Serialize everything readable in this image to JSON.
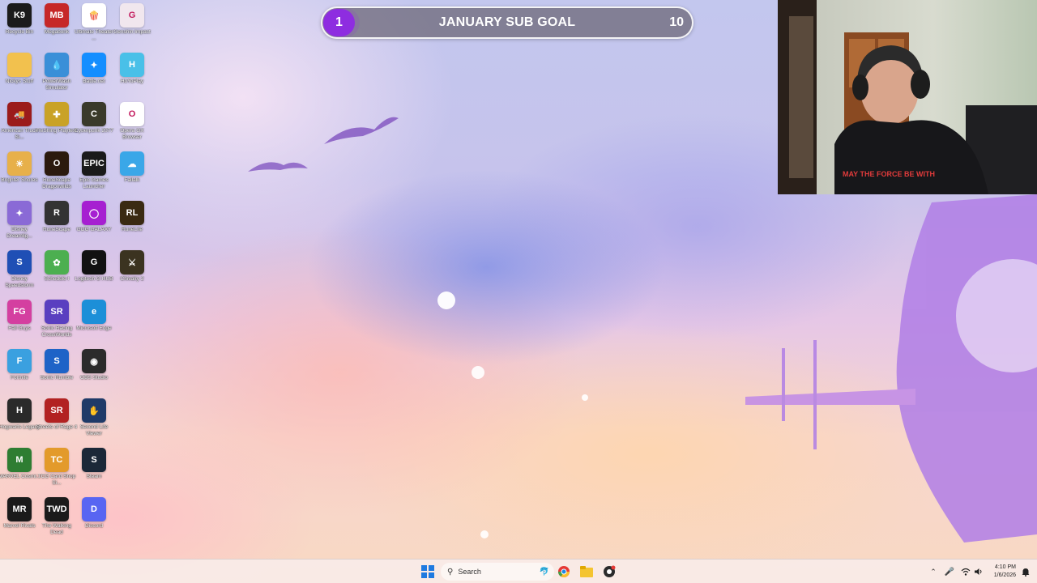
{
  "desktop_icons": [
    {
      "label": "Recycle Bin",
      "glyph": "K9",
      "color": "#1b1b1b"
    },
    {
      "label": "Nickys Stuff",
      "glyph": "",
      "color": "#f2c14e"
    },
    {
      "label": "American Truck Si...",
      "glyph": "🚚",
      "color": "#9b1b1b"
    },
    {
      "label": "Brighter Shores",
      "glyph": "☀",
      "color": "#e7b04a"
    },
    {
      "label": "Disney Dreamlig...",
      "glyph": "✦",
      "color": "#8a6ad6"
    },
    {
      "label": "Disney Speedstorm",
      "glyph": "S",
      "color": "#1f4fb5"
    },
    {
      "label": "Fall Guys",
      "glyph": "FG",
      "color": "#d43fa0"
    },
    {
      "label": "Fortnite",
      "glyph": "F",
      "color": "#3aa0e0"
    },
    {
      "label": "Hogwarts Legacy",
      "glyph": "H",
      "color": "#2a2a2a"
    },
    {
      "label": "MARVEL Cosmi...",
      "glyph": "M",
      "color": "#2e7d32"
    },
    {
      "label": "Marvel Rivals",
      "glyph": "MR",
      "color": "#1a1a1a"
    },
    {
      "label": "Megabonk",
      "glyph": "MB",
      "color": "#c62828"
    },
    {
      "label": "PowerWash Simulator",
      "glyph": "💧",
      "color": "#3a8fd8"
    },
    {
      "label": "ReShing Playtest",
      "glyph": "✚",
      "color": "#c9a227"
    },
    {
      "label": "RuneScape Dragonwilds",
      "glyph": "O",
      "color": "#2b1a0e"
    },
    {
      "label": "RuneScape",
      "glyph": "R",
      "color": "#333333"
    },
    {
      "label": "Schedule I",
      "glyph": "✿",
      "color": "#4caf50"
    },
    {
      "label": "Sonic Racing CrossWorlds",
      "glyph": "SR",
      "color": "#5a3fc0"
    },
    {
      "label": "Sonic Rumble",
      "glyph": "S",
      "color": "#1e63c7"
    },
    {
      "label": "Streets of Rage 4",
      "glyph": "SR",
      "color": "#b22222"
    },
    {
      "label": "TCG Card Shop Si...",
      "glyph": "TC",
      "color": "#e39a2b"
    },
    {
      "label": "The Walking Dead",
      "glyph": "TWD",
      "color": "#1b1b1b"
    },
    {
      "label": "Ultimate Theater ...",
      "glyph": "🍿",
      "color": "#ffffff"
    },
    {
      "label": "Battle.net",
      "glyph": "✦",
      "color": "#148eff"
    },
    {
      "label": "Cyberpunk 2077",
      "glyph": "C",
      "color": "#3a3a2a"
    },
    {
      "label": "Epic Games Launcher",
      "glyph": "EPIC",
      "color": "#1a1a1a"
    },
    {
      "label": "GOG GALAXY",
      "glyph": "◯",
      "color": "#a61fd1"
    },
    {
      "label": "Logitech G HUB",
      "glyph": "G",
      "color": "#111111"
    },
    {
      "label": "Microsoft Edge",
      "glyph": "e",
      "color": "#1c8fd8"
    },
    {
      "label": "OBS Studio",
      "glyph": "◉",
      "color": "#2b2b2b"
    },
    {
      "label": "Second Life Viewer",
      "glyph": "✋",
      "color": "#1f3a68"
    },
    {
      "label": "Steam",
      "glyph": "S",
      "color": "#1b2838"
    },
    {
      "label": "Discord",
      "glyph": "D",
      "color": "#5865f2"
    },
    {
      "label": "Genshin Impact",
      "glyph": "G",
      "color": "#f1e7ee"
    },
    {
      "label": "HoYoPlay",
      "glyph": "H",
      "color": "#49c0e8"
    },
    {
      "label": "Opera GX Browser",
      "glyph": "O",
      "color": "#ffffff"
    },
    {
      "label": "Fallalk",
      "glyph": "☁",
      "color": "#3aa7e8"
    },
    {
      "label": "RuneLite",
      "glyph": "RL",
      "color": "#3a2a12"
    },
    {
      "label": "Chivalry 2",
      "glyph": "⚔",
      "color": "#3b3320"
    }
  ],
  "sub_goal": {
    "current": "1",
    "title": "JANUARY SUB GOAL",
    "target": "10",
    "progress": 0.1,
    "accent": "#8e2de0"
  },
  "webcam": {
    "shirt_text": "MAY THE FORCE BE WITH"
  },
  "taskbar": {
    "search_placeholder": "Search",
    "time": "4:10 PM",
    "date": "1/6/2026",
    "pinned": [
      "start-icon",
      "search-icon",
      "widgets-icon",
      "chrome-icon",
      "file-explorer-icon",
      "obs-icon"
    ],
    "tray": [
      "chevron-up-icon",
      "microphone-icon",
      "wifi-icon",
      "volume-icon",
      "notification-icon"
    ]
  }
}
